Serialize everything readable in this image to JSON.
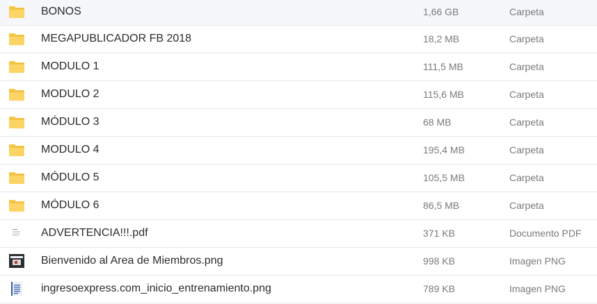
{
  "file_list": {
    "items": [
      {
        "name": "BONOS",
        "size": "1,66 GB",
        "type": "Carpeta",
        "icon": "folder-icon"
      },
      {
        "name": "MEGAPUBLICADOR FB 2018",
        "size": "18,2 MB",
        "type": "Carpeta",
        "icon": "folder-icon"
      },
      {
        "name": "MODULO 1",
        "size": "111,5 MB",
        "type": "Carpeta",
        "icon": "folder-icon"
      },
      {
        "name": "MODULO 2",
        "size": "115,6 MB",
        "type": "Carpeta",
        "icon": "folder-icon"
      },
      {
        "name": "MÓDULO 3",
        "size": "68 MB",
        "type": "Carpeta",
        "icon": "folder-icon"
      },
      {
        "name": "MODULO 4",
        "size": "195,4 MB",
        "type": "Carpeta",
        "icon": "folder-icon"
      },
      {
        "name": "MÓDULO 5",
        "size": "105,5 MB",
        "type": "Carpeta",
        "icon": "folder-icon"
      },
      {
        "name": "MÓDULO 6",
        "size": "86,5 MB",
        "type": "Carpeta",
        "icon": "folder-icon"
      },
      {
        "name": "ADVERTENCIA!!!.pdf",
        "size": "371 KB",
        "type": "Documento PDF",
        "icon": "pdf-thumbnail-icon"
      },
      {
        "name": "Bienvenido al Area de Miembros.png",
        "size": "998 KB",
        "type": "Imagen PNG",
        "icon": "image-thumbnail-icon"
      },
      {
        "name": "ingresoexpress.com_inicio_entrenamiento.png",
        "size": "789 KB",
        "type": "Imagen PNG",
        "icon": "image-thumbnail-icon"
      }
    ]
  },
  "colors": {
    "folder": "#f8c84a",
    "folder_dark": "#e9b334",
    "text": "#2b2b2b",
    "muted": "#7a7a7a",
    "divider": "#e5e5e5"
  }
}
